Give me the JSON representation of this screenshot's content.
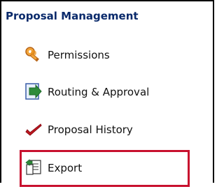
{
  "panel": {
    "title": "Proposal Management"
  },
  "menu": {
    "items": [
      {
        "label": "Permissions",
        "icon": "keys-icon"
      },
      {
        "label": "Routing & Approval",
        "icon": "routing-arrow-icon"
      },
      {
        "label": "Proposal History",
        "icon": "checkmark-icon"
      },
      {
        "label": "Export",
        "icon": "export-document-icon"
      }
    ],
    "highlighted_item": "Export"
  },
  "colors": {
    "title": "#0a2a6b",
    "highlight_border": "#c8102e",
    "key_icon": "#e8901c",
    "routing_icon": "#2e8b3a",
    "check_icon": "#c0161f"
  }
}
